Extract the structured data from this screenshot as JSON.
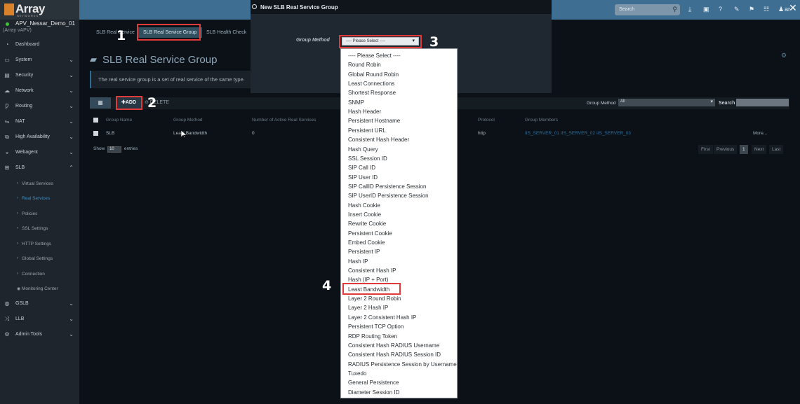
{
  "sidebar": {
    "logo": "Array",
    "logo_sub": "NETWORKS",
    "device_name": "APV_Nessar_Demo_01",
    "device_sub": "(Array vAPV)",
    "items": [
      {
        "label": "Dashboard",
        "icon": "dashboard-icon",
        "glyph": "◔",
        "chevron": ""
      },
      {
        "label": "System",
        "icon": "monitor-icon",
        "glyph": "▭",
        "chevron": "⌄"
      },
      {
        "label": "Security",
        "icon": "briefcase-icon",
        "glyph": "▤",
        "chevron": "⌄"
      },
      {
        "label": "Network",
        "icon": "cloud-icon",
        "glyph": "☁",
        "chevron": "⌄"
      },
      {
        "label": "Routing",
        "icon": "route-icon",
        "glyph": "Ƿ",
        "chevron": "⌄"
      },
      {
        "label": "NAT",
        "icon": "nat-icon",
        "glyph": "⇋",
        "chevron": "⌄"
      },
      {
        "label": "High Availability",
        "icon": "ha-icon",
        "glyph": "⧉",
        "chevron": "⌄"
      },
      {
        "label": "Webagent",
        "icon": "webagent-icon",
        "glyph": "◒",
        "chevron": "⌄"
      },
      {
        "label": "SLB",
        "icon": "sitemap-icon",
        "glyph": "⊞",
        "chevron": "⌃"
      }
    ],
    "sub_items": [
      {
        "label": "Virtual Services",
        "bullet": "›"
      },
      {
        "label": "Real Services",
        "bullet": "›"
      },
      {
        "label": "Policies",
        "bullet": "›"
      },
      {
        "label": "SSL Settings",
        "bullet": "›"
      },
      {
        "label": "HTTP Settings",
        "bullet": "›"
      },
      {
        "label": "Global Settings",
        "bullet": "›"
      },
      {
        "label": "Connection",
        "bullet": "›"
      },
      {
        "label": "Monitoring Center",
        "bullet": "◉"
      }
    ],
    "bottom_items": [
      {
        "label": "GSLB",
        "icon": "globe-icon",
        "glyph": "◍",
        "chevron": "⌄"
      },
      {
        "label": "LLB",
        "icon": "shuffle-icon",
        "glyph": "⤨",
        "chevron": "⌄"
      },
      {
        "label": "Admin Tools",
        "icon": "cogs-icon",
        "glyph": "⚙",
        "chevron": "⌄"
      }
    ]
  },
  "topbar": {
    "search_placeholder": "Search",
    "search_glyph": "⚲",
    "icons": [
      {
        "name": "download-icon",
        "glyph": "⤓"
      },
      {
        "name": "save-icon",
        "glyph": "▣"
      },
      {
        "name": "help-icon",
        "glyph": "?"
      },
      {
        "name": "wizard-icon",
        "glyph": "✎"
      },
      {
        "name": "flag-icon",
        "glyph": "⚑"
      },
      {
        "name": "users-icon",
        "glyph": "☷"
      },
      {
        "name": "user-icon",
        "glyph": "♟"
      }
    ],
    "user_label": "ar",
    "close_glyph": "✕"
  },
  "tabs": [
    "SLB Real Service",
    "SLB Real Service Group",
    "SLB Health Check"
  ],
  "page": {
    "title": "SLB Real Service Group",
    "folder_glyph": "▰",
    "description": "The real service group is a set of real service of the same type.",
    "settings_glyph": "⚙"
  },
  "actions": {
    "grid_glyph": "▦",
    "add_label": "✚ADD",
    "delete_label": "⊖ DELETE",
    "group_method_label": "Group Method",
    "group_method_value": "All",
    "search_label": "Search"
  },
  "table": {
    "headers": [
      "Group Name",
      "Group Method",
      "Number of Active Real Services",
      "Protocol",
      "Group Members"
    ],
    "row": {
      "name": "SLB",
      "method": "Least Bandwidth",
      "active": "0",
      "protocol": "http",
      "members": [
        "IIS_SERVER_01",
        "IIS_SERVER_02",
        "IIS_SERVER_03"
      ],
      "more": "More..."
    },
    "show_prefix": "Show",
    "show_value": "10",
    "show_suffix": "entries",
    "pager": [
      "First",
      "Previous",
      "1",
      "Next",
      "Last"
    ]
  },
  "modal": {
    "title": "New SLB Real Service Group",
    "field_label": "Group Method",
    "dropdown_value": "---- Please Select ----",
    "options": [
      "---- Please Select ----",
      "Round Robin",
      "Global Round Robin",
      "Least Connections",
      "Shortest Response",
      "SNMP",
      "Hash Header",
      "Persistent Hostname",
      "Persistent URL",
      "Consistent Hash Header",
      "Hash Query",
      "SSL Session ID",
      "SIP Call ID",
      "SIP User ID",
      "SIP CallID Persistence Session",
      "SIP UserID Persistence Session",
      "Hash Cookie",
      "Insert Cookie",
      "Rewrite Cookie",
      "Persistent Cookie",
      "Embed Cookie",
      "Persistent IP",
      "Hash IP",
      "Consistent Hash IP",
      "Hash (IP + Port)",
      "Least Bandwidth",
      "Layer 2 Round Robin",
      "Layer 2 Hash IP",
      "Layer 2 Consistent Hash IP",
      "Persistent TCP Option",
      "RDP Routing Token",
      "Consistent Hash RADIUS Username",
      "Consistent Hash RADIUS Session ID",
      "RADIUS Persistence Session by Username",
      "Tuxedo",
      "General Persistence",
      "Diameter Session ID"
    ]
  },
  "annotations": [
    "1",
    "2",
    "3",
    "4"
  ],
  "colors": {
    "accent": "#3f6e93",
    "highlight": "#e03a3a",
    "sidebar": "#1e252c"
  }
}
